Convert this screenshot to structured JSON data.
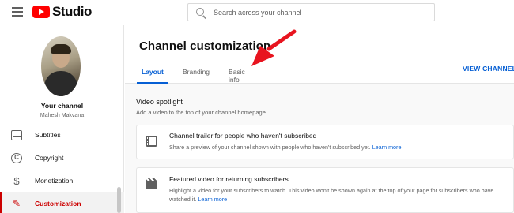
{
  "app": {
    "name": "Studio"
  },
  "search": {
    "placeholder": "Search across your channel"
  },
  "sidebar": {
    "channel_title": "Your channel",
    "channel_owner": "Mahesh Makvana",
    "items": [
      {
        "label": "Subtitles",
        "icon": "subtitles-icon",
        "active": false
      },
      {
        "label": "Copyright",
        "icon": "copyright-icon",
        "active": false
      },
      {
        "label": "Monetization",
        "icon": "monetization-icon",
        "active": false
      },
      {
        "label": "Customization",
        "icon": "customization-wand-icon",
        "active": true
      }
    ]
  },
  "main": {
    "title": "Channel customization",
    "tabs": [
      {
        "label": "Layout",
        "active": true
      },
      {
        "label": "Branding",
        "active": false
      },
      {
        "label": "Basic info",
        "active": false
      }
    ],
    "view_channel": "VIEW CHANNEL",
    "section": {
      "title": "Video spotlight",
      "description": "Add a video to the top of your channel homepage"
    },
    "cards": [
      {
        "title": "Channel trailer for people who haven't subscribed",
        "description": "Share a preview of your channel shown with people who haven't subscribed yet.",
        "link": "Learn more"
      },
      {
        "title": "Featured video for returning subscribers",
        "description_line1": "Highlight a video for your subscribers to watch. This video won't be shown again at the top of your page for subscribers who have",
        "description_line2": "watched it.",
        "link": "Learn more"
      }
    ]
  },
  "colors": {
    "accent": "#065fd4",
    "brand_red": "#ff0000",
    "active_red": "#cc0000",
    "annotation_arrow": "#e8141f"
  }
}
